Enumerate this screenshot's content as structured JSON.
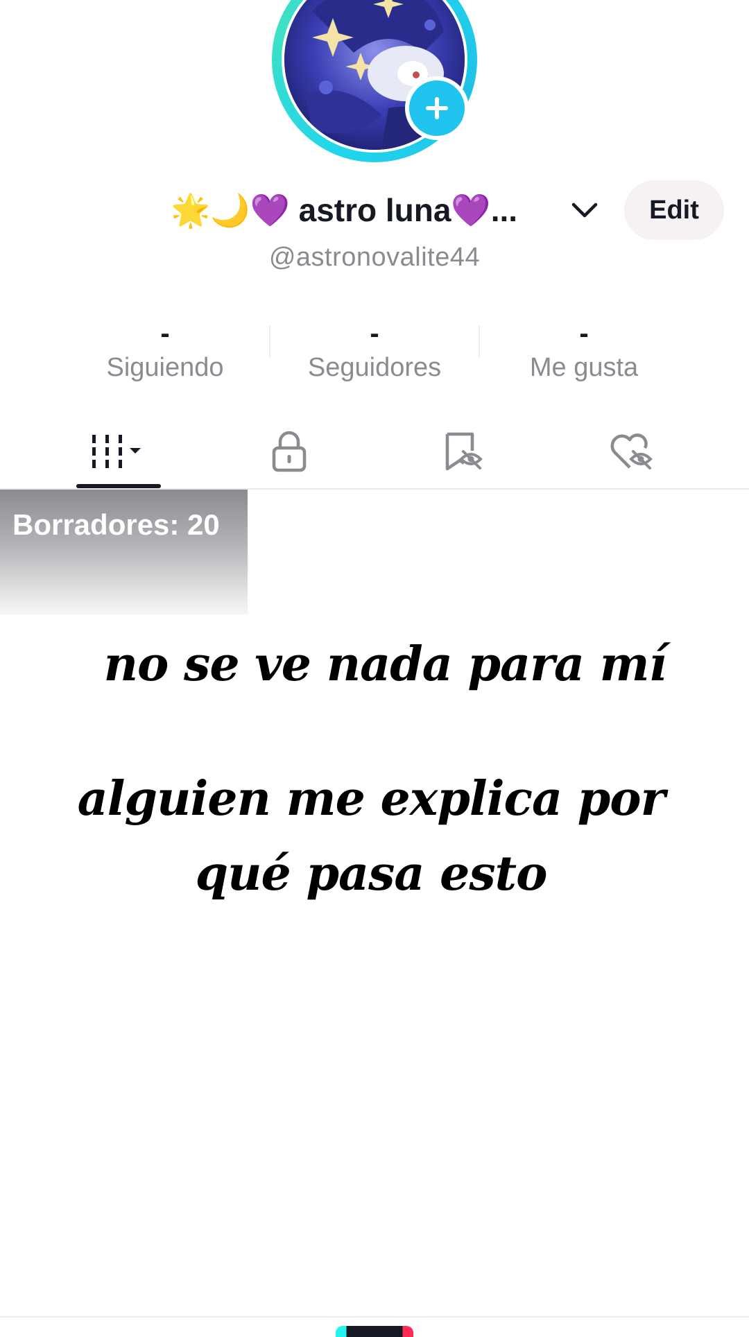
{
  "profile": {
    "display_name": "🌟🌙💜 astro luna💜...",
    "username": "@astronovalite44",
    "edit_label": "Edit"
  },
  "stats": [
    {
      "value": "-",
      "label": "Siguiendo"
    },
    {
      "value": "-",
      "label": "Seguidores"
    },
    {
      "value": "-",
      "label": "Me gusta"
    }
  ],
  "tabs": [
    {
      "icon": "grid-icon",
      "active": true
    },
    {
      "icon": "lock-icon",
      "active": false
    },
    {
      "icon": "bookmark-hidden-icon",
      "active": false
    },
    {
      "icon": "liked-hidden-icon",
      "active": false
    }
  ],
  "drafts": {
    "label": "Borradores: 20"
  },
  "overlay_text": {
    "line1": "no se ve nada para mí",
    "line2": "alguien me explica por qué pasa esto"
  },
  "colors": {
    "accent_cyan": "#20c4ee",
    "text_primary": "#161823",
    "text_secondary": "#8a8b91"
  }
}
